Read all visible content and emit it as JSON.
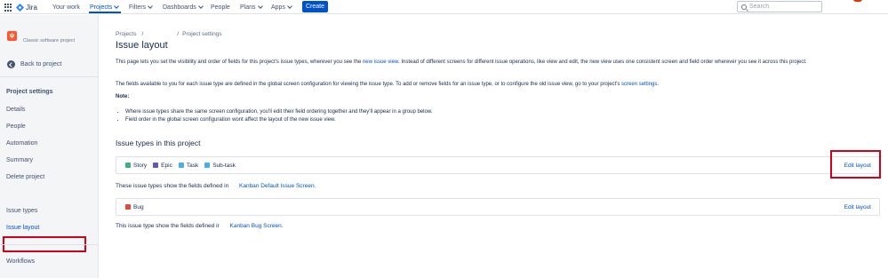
{
  "topnav": {
    "logo_text": "Jira",
    "items": [
      "Your work",
      "Projects",
      "Filters",
      "Dashboards",
      "People",
      "Plans",
      "Apps"
    ],
    "create_label": "Create",
    "search_placeholder": "Search"
  },
  "sidebar": {
    "project_type": "Classic software project",
    "back_label": "Back to project",
    "heading": "Project settings",
    "items": [
      "Details",
      "People",
      "Automation",
      "Summary",
      "Delete project",
      "Issue types",
      "Issue layout",
      "Workflows"
    ],
    "colors": {
      "highlight": "#d0021b",
      "avatar": "#ff5630"
    }
  },
  "main": {
    "breadcrumb": [
      "Projects",
      "/",
      "/",
      "Project settings"
    ],
    "title": "Issue layout",
    "para1_a": "This page lets you set the visibility and order of fields for this project's issue types, wherever you see the ",
    "para1_link": "new issue view",
    "para1_b": ". Instead of different screens for different issue operations, like view and edit, the new view uses one consistent screen and field order wherever you see it across this project.",
    "para2_a": "The fields available to you for each issue type are defined in the global screen configuration for viewing the issue type. To add or remove fields for an issue type, or to configure the old issue view, go to your project's ",
    "para2_link": "screen settings",
    "para2_b": ".",
    "note_label": "Note:",
    "bullets": [
      "Where issue types share the same screen configuration, you'll edit their field ordering together and they'll appear in a group below.",
      "Field order in the global screen configuration wont affect the layout of the new issue view."
    ],
    "section_title": "Issue types in this project",
    "group1": {
      "types": [
        "Story",
        "Epic",
        "Task",
        "Sub-task"
      ],
      "edit_label": "Edit layout",
      "screen_text": "These issue types show the fields defined in",
      "screen_link": "Kanban Default Issue Screen."
    },
    "group2": {
      "types": [
        "Bug"
      ],
      "edit_label": "Edit layout",
      "screen_text": "This issue type show the fields defined ir",
      "screen_link": "Kanban Bug Screen."
    }
  }
}
